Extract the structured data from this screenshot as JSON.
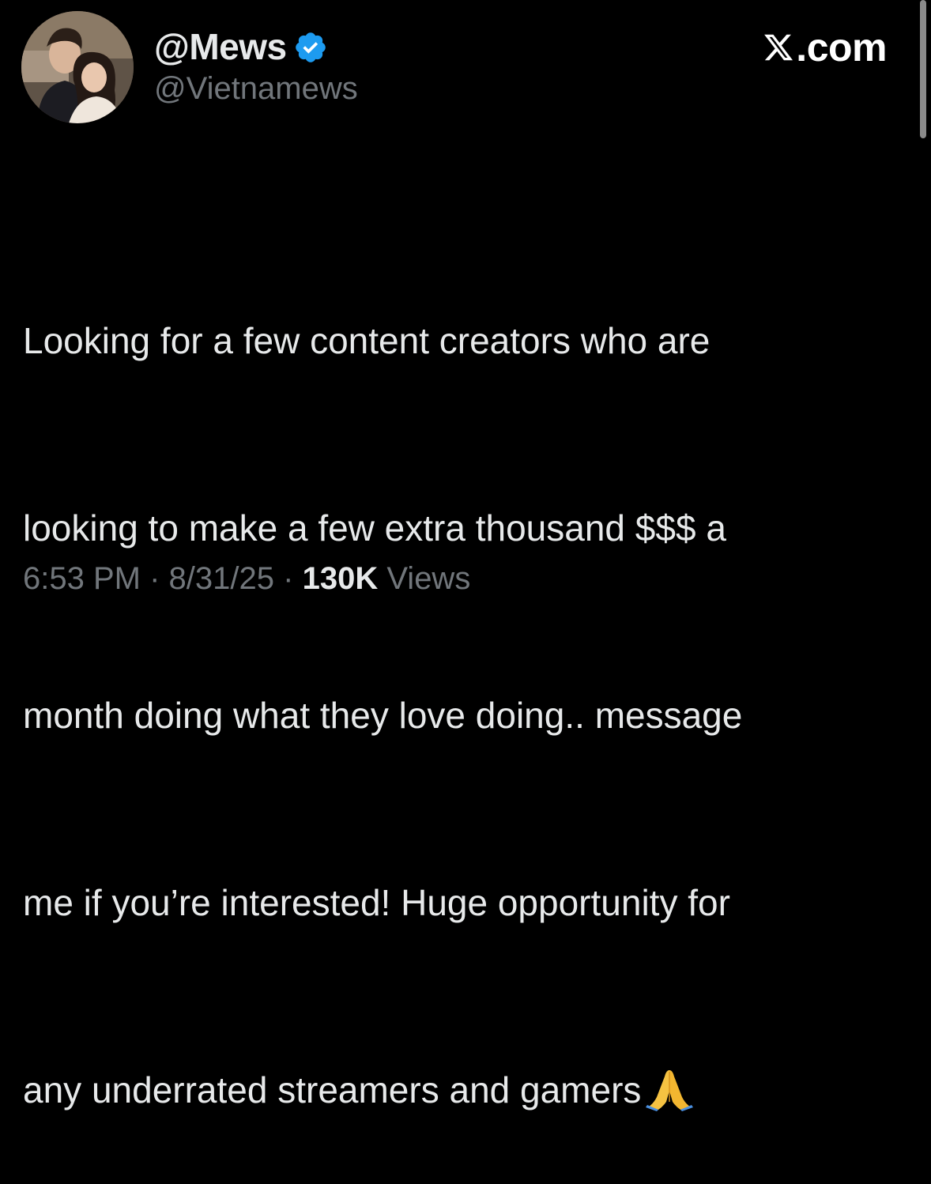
{
  "author": {
    "display_name": "@Mews",
    "handle": "@Vietnamews",
    "verified_icon": "verified-badge-icon",
    "avatar_icon": "profile-photo"
  },
  "brand": {
    "logo_icon": "x-logo-icon",
    "text": ".com"
  },
  "tweet": {
    "lines": [
      "Looking for a few content creators who are",
      "looking to make a few extra thousand $$$ a",
      "month doing what they love doing.. message",
      "me if you’re interested! Huge opportunity for",
      "any underrated streamers and gamers"
    ],
    "emoji_icon": "folded-hands-icon"
  },
  "meta": {
    "time": "6:53 PM",
    "separator": "·",
    "date": "8/31/25",
    "views_count": "130K",
    "views_label": "Views"
  },
  "colors": {
    "background": "#000000",
    "text_primary": "#e7e9ea",
    "text_secondary": "#71767b",
    "verified": "#1d9bf0"
  }
}
